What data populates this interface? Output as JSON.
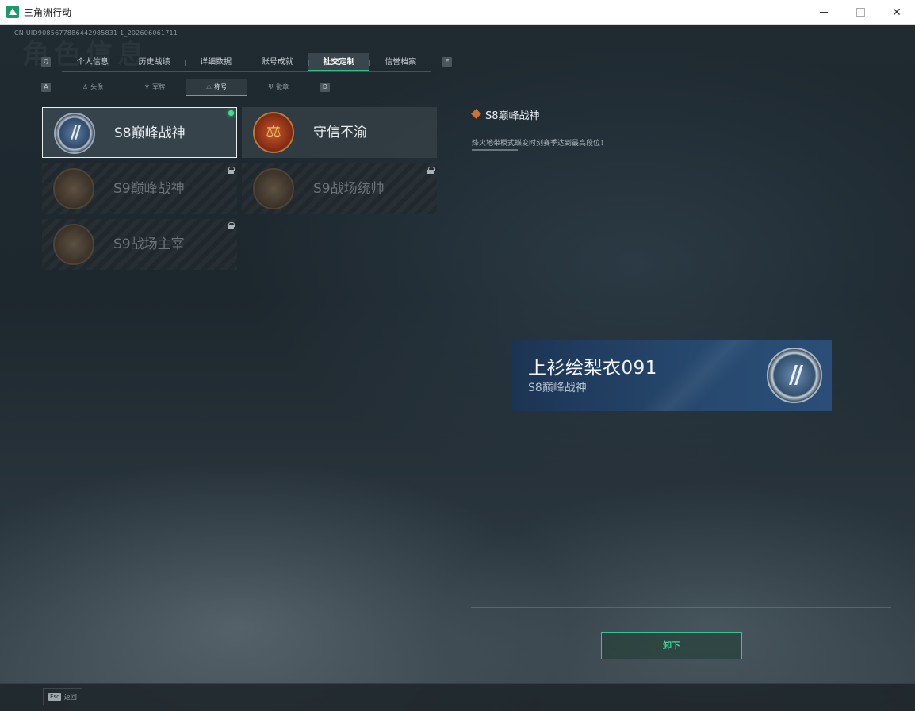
{
  "window": {
    "title": "三角洲行动"
  },
  "header": {
    "uid": "CN:UID9085677886442985831 1_202606061711",
    "ghost_title": "角色信息"
  },
  "key_hints": {
    "tabs_left": "Q",
    "tabs_right": "E",
    "subtabs_left": "A",
    "subtabs_right": "D"
  },
  "tabs": [
    {
      "label": "个人信息",
      "active": false
    },
    {
      "label": "历史战绩",
      "active": false
    },
    {
      "label": "详细数据",
      "active": false
    },
    {
      "label": "账号成就",
      "active": false
    },
    {
      "label": "社交定制",
      "active": true
    },
    {
      "label": "信誉档案",
      "active": false
    }
  ],
  "subtabs": [
    {
      "label": "头像",
      "icon": "person-icon",
      "active": false
    },
    {
      "label": "军牌",
      "icon": "dogtag-icon",
      "active": false
    },
    {
      "label": "称号",
      "icon": "title-icon",
      "active": true
    },
    {
      "label": "徽章",
      "icon": "medal-icon",
      "active": false
    }
  ],
  "titles": [
    {
      "name": "S8巅峰战神",
      "badge": "s8-peak-badge-icon",
      "selected": true,
      "equipped": true,
      "locked": false
    },
    {
      "name": "守信不渝",
      "badge": "scales-badge-icon",
      "selected": false,
      "equipped": false,
      "locked": false
    },
    {
      "name": "S9巅峰战神",
      "badge": "fortress-badge-icon",
      "selected": false,
      "equipped": false,
      "locked": true
    },
    {
      "name": "S9战场统帅",
      "badge": "warship-badge-icon",
      "selected": false,
      "equipped": false,
      "locked": true
    },
    {
      "name": "S9战场主宰",
      "badge": "mushroom-cloud-badge-icon",
      "selected": false,
      "equipped": false,
      "locked": true
    }
  ],
  "detail": {
    "title": "S8巅峰战神",
    "description": "烽火地带模式蝶变时刻赛季达到最高段位！"
  },
  "preview": {
    "player_name": "上衫绘梨衣091",
    "title": "S8巅峰战神"
  },
  "actions": {
    "unequip_label": "卸下"
  },
  "footer": {
    "esc_key": "Esc",
    "back_label": "返回"
  },
  "colors": {
    "accent": "#35c08a",
    "equipped_dot": "#3ee08a",
    "detail_icon": "#d0712e"
  }
}
